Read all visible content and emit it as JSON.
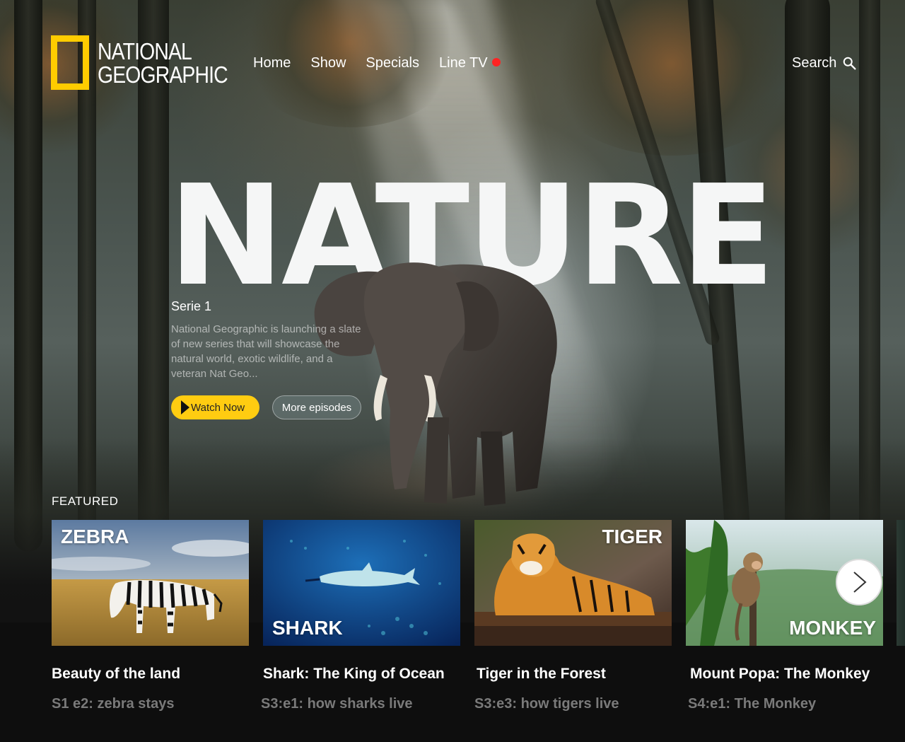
{
  "brand": {
    "line1": "NATIONAL",
    "line2": "GEOGRAPHIC",
    "accent": "#ffcc00"
  },
  "nav": {
    "items": [
      "Home",
      "Show",
      "Specials",
      "Line TV"
    ],
    "live_dot_color": "#ff2323"
  },
  "search": {
    "label": "Search",
    "icon": "search-icon"
  },
  "hero": {
    "headline": "NATURE",
    "series": "Serie 1",
    "description": "National Geographic is launching a slate of new series that will showcase the natural world, exotic wildlife, and a veteran Nat Geo...",
    "watch_label": "Watch Now",
    "more_label": "More episodes",
    "watch_color": "#ffcc11"
  },
  "featured": {
    "label": "FEATURED",
    "cards": [
      {
        "tag": "ZEBRA",
        "title": "Beauty of the land",
        "episode": "S1 e2: zebra stays"
      },
      {
        "tag": "SHARK",
        "title": "Shark: The King of Ocean",
        "episode": "S3:e1: how sharks live"
      },
      {
        "tag": "TIGER",
        "title": "Tiger in the Forest",
        "episode": "S3:e3: how tigers live"
      },
      {
        "tag": "MONKEY",
        "title": "Mount Popa: The Monkey",
        "episode": "S4:e1: The Monkey"
      }
    ],
    "next_icon": "chevron-right-icon"
  }
}
